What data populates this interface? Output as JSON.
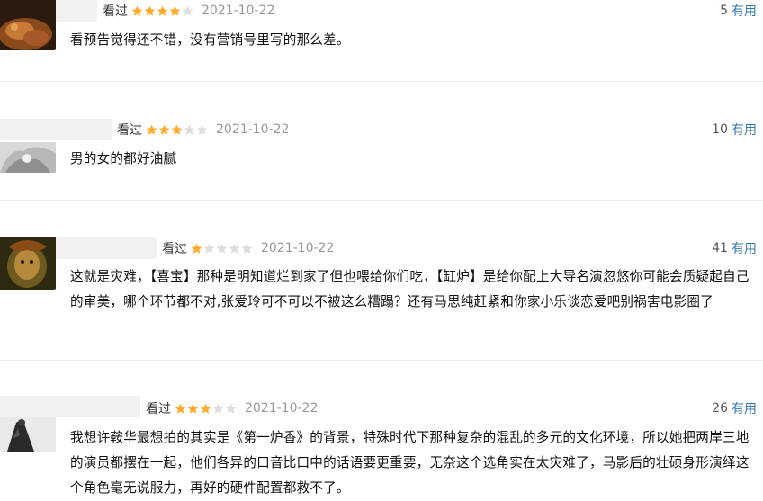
{
  "colors": {
    "accent_link": "#3377aa",
    "star_on": "#ffac2d",
    "star_off": "#dddddd",
    "date": "#999999"
  },
  "reviews": [
    {
      "status": "看过",
      "rating": 4,
      "date": "2021-10-22",
      "votes": "5",
      "useful_label": "有用",
      "content": "看预告觉得还不错，没有营销号里写的那么差。"
    },
    {
      "status": "看过",
      "rating": 3,
      "date": "2021-10-22",
      "votes": "10",
      "useful_label": "有用",
      "content": "男的女的都好油腻"
    },
    {
      "status": "看过",
      "rating": 1,
      "date": "2021-10-22",
      "votes": "41",
      "useful_label": "有用",
      "content": "这就是灾难，【喜宝】那种是明知道烂到家了但也喂给你们吃，【缸炉】是给你配上大导名演忽悠你可能会质疑起自己的审美，哪个环节都不对,张爱玲可不可以不被这么糟蹋？还有马思纯赶紧和你家小乐谈恋爱吧别祸害电影圈了"
    },
    {
      "status": "看过",
      "rating": 3,
      "date": "2021-10-22",
      "votes": "26",
      "useful_label": "有用",
      "content": "我想许鞍华最想拍的其实是《第一炉香》的背景，特殊时代下那种复杂的混乱的多元的文化环境，所以她把两岸三地的演员都摆在一起，他们各异的口音比口中的话语要更重要，无奈这个选角实在太灾难了，马影后的壮硕身形演绎这个角色毫无说服力，再好的硬件配置都救不了。"
    }
  ]
}
